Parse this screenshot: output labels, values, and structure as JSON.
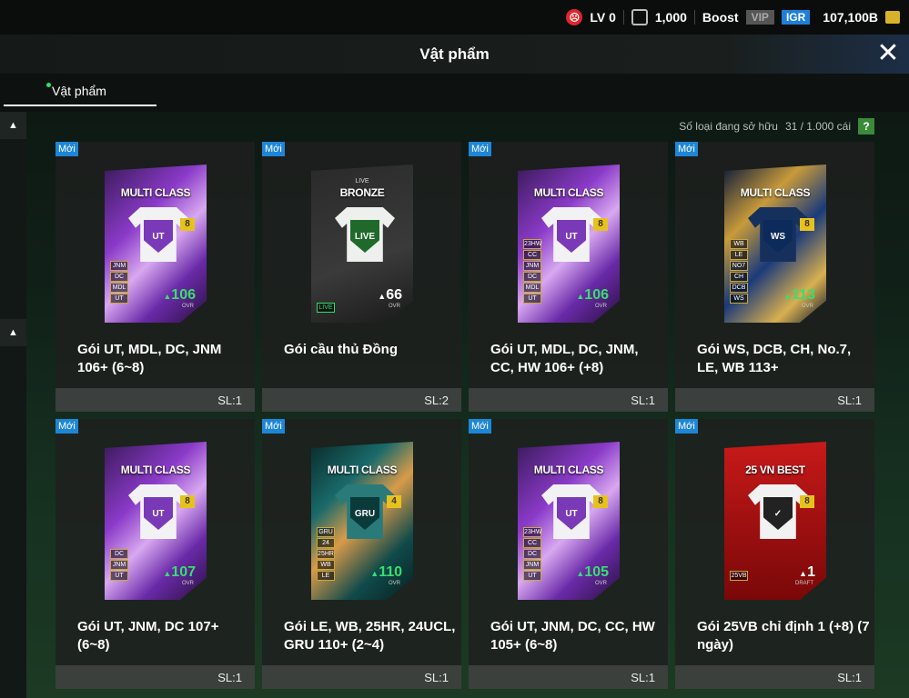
{
  "topbar": {
    "level": "LV 0",
    "coins": "1,000",
    "boost": "Boost",
    "vip": "VIP",
    "igr": "IGR",
    "bp": "107,100B"
  },
  "title": "Vật phẩm",
  "tab": "Vật phẩm",
  "owned": {
    "label": "Số loại đang sở hữu",
    "value": "31 / 1.000 cái",
    "help": "?"
  },
  "badge_new": "Mới",
  "items": [
    {
      "name": "Gói UT, MDL, DC, JNM 106+ (6~8)",
      "qty": "SL:1",
      "pack_title": "MULTI CLASS",
      "rank": "8",
      "ovr": "106",
      "positions": [
        "JNM",
        "DC",
        "MDL",
        "UT"
      ],
      "crest": "UT",
      "style": "purple"
    },
    {
      "name": "Gói cầu thủ Đồng",
      "qty": "SL:2",
      "pack_sub": "LIVE",
      "pack_title": "BRONZE",
      "crest": "LIVE",
      "ovr": "66",
      "tag": "LIVE",
      "style": "bronze"
    },
    {
      "name": "Gói UT, MDL, DC, JNM, CC, HW 106+ (+8)",
      "qty": "SL:1",
      "pack_title": "MULTI CLASS",
      "rank": "8",
      "ovr": "106",
      "positions": [
        "23HW",
        "CC",
        "JNM",
        "DC",
        "MDL",
        "UT"
      ],
      "crest": "UT",
      "style": "purple"
    },
    {
      "name": "Gói WS, DCB, CH, No.7, LE, WB 113+",
      "qty": "SL:1",
      "pack_title": "MULTI CLASS",
      "rank": "8",
      "ovr": "113",
      "positions": [
        "WB",
        "LE",
        "NO7",
        "CH",
        "DCB",
        "WS"
      ],
      "crest": "WS",
      "style": "gold"
    },
    {
      "name": "Gói UT, JNM, DC 107+ (6~8)",
      "qty": "SL:1",
      "pack_title": "MULTI CLASS",
      "rank": "8",
      "ovr": "107",
      "positions": [
        "DC",
        "JNM",
        "UT"
      ],
      "crest": "UT",
      "style": "purple"
    },
    {
      "name": "Gói LE, WB, 25HR, 24UCL, GRU 110+ (2~4)",
      "qty": "SL:1",
      "pack_title": "MULTI CLASS",
      "rank": "4",
      "ovr": "110",
      "positions": [
        "GRU",
        "24",
        "25HR",
        "WB",
        "LE"
      ],
      "crest": "GRU",
      "style": "teal"
    },
    {
      "name": "Gói UT, JNM, DC, CC, HW 105+ (6~8)",
      "qty": "SL:1",
      "pack_title": "MULTI CLASS",
      "rank": "8",
      "ovr": "105",
      "positions": [
        "23HW",
        "CC",
        "DC",
        "JNM",
        "UT"
      ],
      "crest": "UT",
      "style": "purple"
    },
    {
      "name": "Gói 25VB chỉ định 1 (+8) (7 ngày)",
      "qty": "SL:1",
      "pack_title": "25 VN BEST",
      "rank": "8",
      "ovr": "1",
      "ovr_label": "DRAFT",
      "positions": [
        "25VB"
      ],
      "crest": "✓",
      "style": "red"
    }
  ],
  "ovr_label": "OVR",
  "colors": {
    "accent_green": "#36e06e",
    "badge_blue": "#1e86d6",
    "tab_dot": "#2fe06a"
  }
}
